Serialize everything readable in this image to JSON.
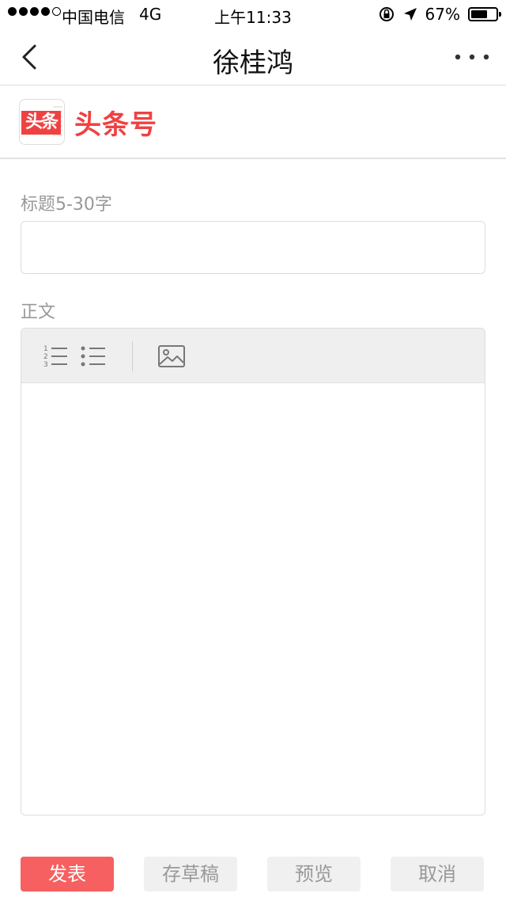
{
  "status_bar": {
    "carrier": "中国电信",
    "network": "4G",
    "time": "上午11:33",
    "battery": "67%",
    "battery_level": 0.67
  },
  "nav": {
    "title": "徐桂鸿",
    "back_icon": "chevron-left-icon",
    "more_icon": "more-horizontal-icon"
  },
  "brand": {
    "logo_text": "头条",
    "name": "头条号",
    "color": "#f04142"
  },
  "form": {
    "title_label": "标题5-30字",
    "title_value": "",
    "body_label": "正文",
    "toolbar": {
      "ordered_list_icon": "ordered-list-icon",
      "bullet_list_icon": "bullet-list-icon",
      "image_icon": "image-icon"
    }
  },
  "actions": {
    "publish": "发表",
    "draft": "存草稿",
    "preview": "预览",
    "cancel": "取消",
    "publish_color": "#f66060"
  }
}
